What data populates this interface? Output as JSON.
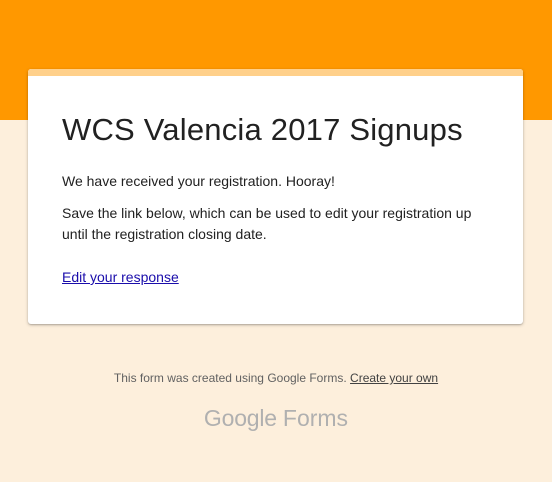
{
  "colors": {
    "header_band": "#ff9800",
    "page_background": "#fdefdc",
    "card_accent": "#ffd08a",
    "link": "#1a0dab"
  },
  "form": {
    "title": "WCS Valencia 2017 Signups",
    "confirmation_message": "We have received your registration. Hooray!",
    "save_message": "Save the link below, which can be used to edit your registration up until the registration closing date.",
    "edit_link_label": "Edit your response"
  },
  "footer": {
    "created_text": "This form was created using Google Forms.",
    "create_link_label": "Create your own",
    "brand_google": "Google",
    "brand_forms": "Forms"
  }
}
